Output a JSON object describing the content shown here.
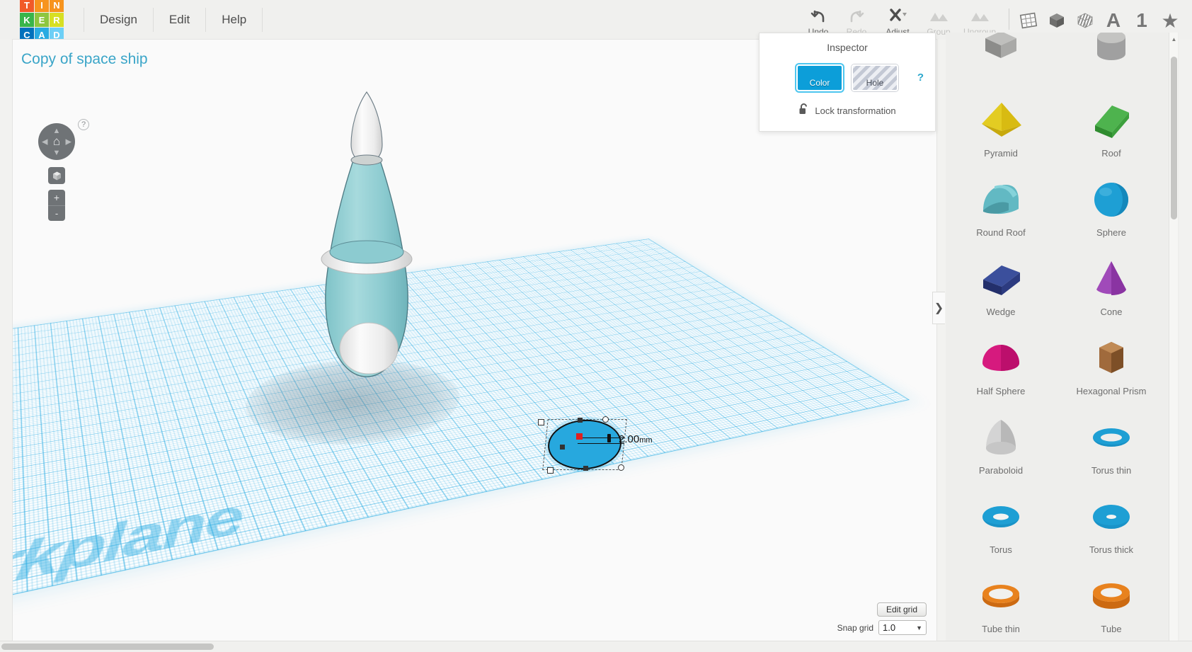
{
  "app": {
    "logo_letters": [
      "T",
      "I",
      "N",
      "K",
      "E",
      "R",
      "C",
      "A",
      "D"
    ]
  },
  "menu": {
    "items": [
      {
        "label": "Design"
      },
      {
        "label": "Edit"
      },
      {
        "label": "Help"
      }
    ]
  },
  "toolbar": {
    "undo_label": "Undo",
    "redo_label": "Redo",
    "adjust_label": "Adjust",
    "group_label": "Group",
    "ungroup_label": "Ungroup",
    "view_icons": [
      {
        "name": "workplane-icon",
        "glyph": ""
      },
      {
        "name": "box-solid-icon",
        "glyph": ""
      },
      {
        "name": "box-striped-icon",
        "glyph": ""
      },
      {
        "name": "text-icon",
        "glyph": "A"
      },
      {
        "name": "number-icon",
        "glyph": "1"
      },
      {
        "name": "favorite-icon",
        "glyph": "★"
      }
    ]
  },
  "canvas": {
    "design_title": "Copy of space ship",
    "workplane_watermark": "rkplane",
    "help_glyph": "?",
    "nav": {
      "home_glyph": "⌂",
      "arrow_up": "▲",
      "arrow_down": "▼",
      "arrow_left": "◀",
      "arrow_right": "▶",
      "zoom_in": "+",
      "zoom_out": "-"
    },
    "selection": {
      "dimension_value": "2.00",
      "dimension_unit": "mm",
      "shape_color": "#27a8de"
    },
    "grid_controls": {
      "edit_grid_label": "Edit grid",
      "snap_grid_label": "Snap grid",
      "snap_grid_value": "1.0",
      "snap_caret": "▼"
    },
    "collapse_glyph": "❯"
  },
  "inspector": {
    "title": "Inspector",
    "color_label": "Color",
    "hole_label": "Hole",
    "help_glyph": "?",
    "lock_label": "Lock transformation",
    "color_value": "#0c9ed9"
  },
  "shapes_panel": {
    "items": [
      {
        "label": "",
        "name": "shape-box",
        "color": "#9b9b9b",
        "kind": "partial-top"
      },
      {
        "label": "",
        "name": "shape-cylinder",
        "color": "#9b9b9b",
        "kind": "partial-top"
      },
      {
        "label": "Pyramid",
        "name": "shape-pyramid",
        "color": "#e8c820",
        "kind": "pyramid"
      },
      {
        "label": "Roof",
        "name": "shape-roof",
        "color": "#3cad3c",
        "kind": "roof"
      },
      {
        "label": "Round Roof",
        "name": "shape-round-roof",
        "color": "#4fadb8",
        "kind": "round-roof"
      },
      {
        "label": "Sphere",
        "name": "shape-sphere",
        "color": "#1e9fd4",
        "kind": "sphere"
      },
      {
        "label": "Wedge",
        "name": "shape-wedge",
        "color": "#2c3b80",
        "kind": "wedge"
      },
      {
        "label": "Cone",
        "name": "shape-cone",
        "color": "#9b3fb5",
        "kind": "cone"
      },
      {
        "label": "Half Sphere",
        "name": "shape-half-sphere",
        "color": "#d61a7e",
        "kind": "half-sphere"
      },
      {
        "label": "Hexagonal Prism",
        "name": "shape-hexagonal-prism",
        "color": "#8a5a32",
        "kind": "hex-prism"
      },
      {
        "label": "Paraboloid",
        "name": "shape-paraboloid",
        "color": "#cfcfcf",
        "kind": "paraboloid"
      },
      {
        "label": "Torus thin",
        "name": "shape-torus-thin",
        "color": "#1e9fd4",
        "kind": "torus-thin"
      },
      {
        "label": "Torus",
        "name": "shape-torus",
        "color": "#1e9fd4",
        "kind": "torus"
      },
      {
        "label": "Torus thick",
        "name": "shape-torus-thick",
        "color": "#1e9fd4",
        "kind": "torus-thick"
      },
      {
        "label": "Tube thin",
        "name": "shape-tube-thin",
        "color": "#e8821e",
        "kind": "tube-thin"
      },
      {
        "label": "Tube",
        "name": "shape-tube",
        "color": "#e8821e",
        "kind": "tube"
      }
    ]
  }
}
